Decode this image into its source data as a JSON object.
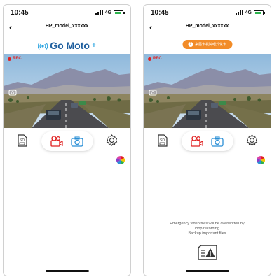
{
  "status_bar": {
    "time": "10:45",
    "network": "4G"
  },
  "nav": {
    "back_glyph": "‹",
    "title": "HP_model_xxxxxx"
  },
  "logo": {
    "text": "Go Moto",
    "plus": "+"
  },
  "banner": {
    "text": "来届卡机障眼式化卡"
  },
  "video": {
    "rec_label": "REC"
  },
  "emergency": {
    "line1": "Emergency video files will be overwritten by",
    "line2": "loop recording",
    "line3": "Backup important files"
  },
  "colors": {
    "accent": "#f28c28",
    "rec": "#e02020",
    "brand": "#1f5f9e",
    "camera": "#2b8fd6"
  },
  "icons": [
    "sd-card-icon",
    "video-camera-icon",
    "photo-camera-icon",
    "gear-icon",
    "colorwheel-icon",
    "emergency-file-icon",
    "wifi-signal-icon"
  ]
}
